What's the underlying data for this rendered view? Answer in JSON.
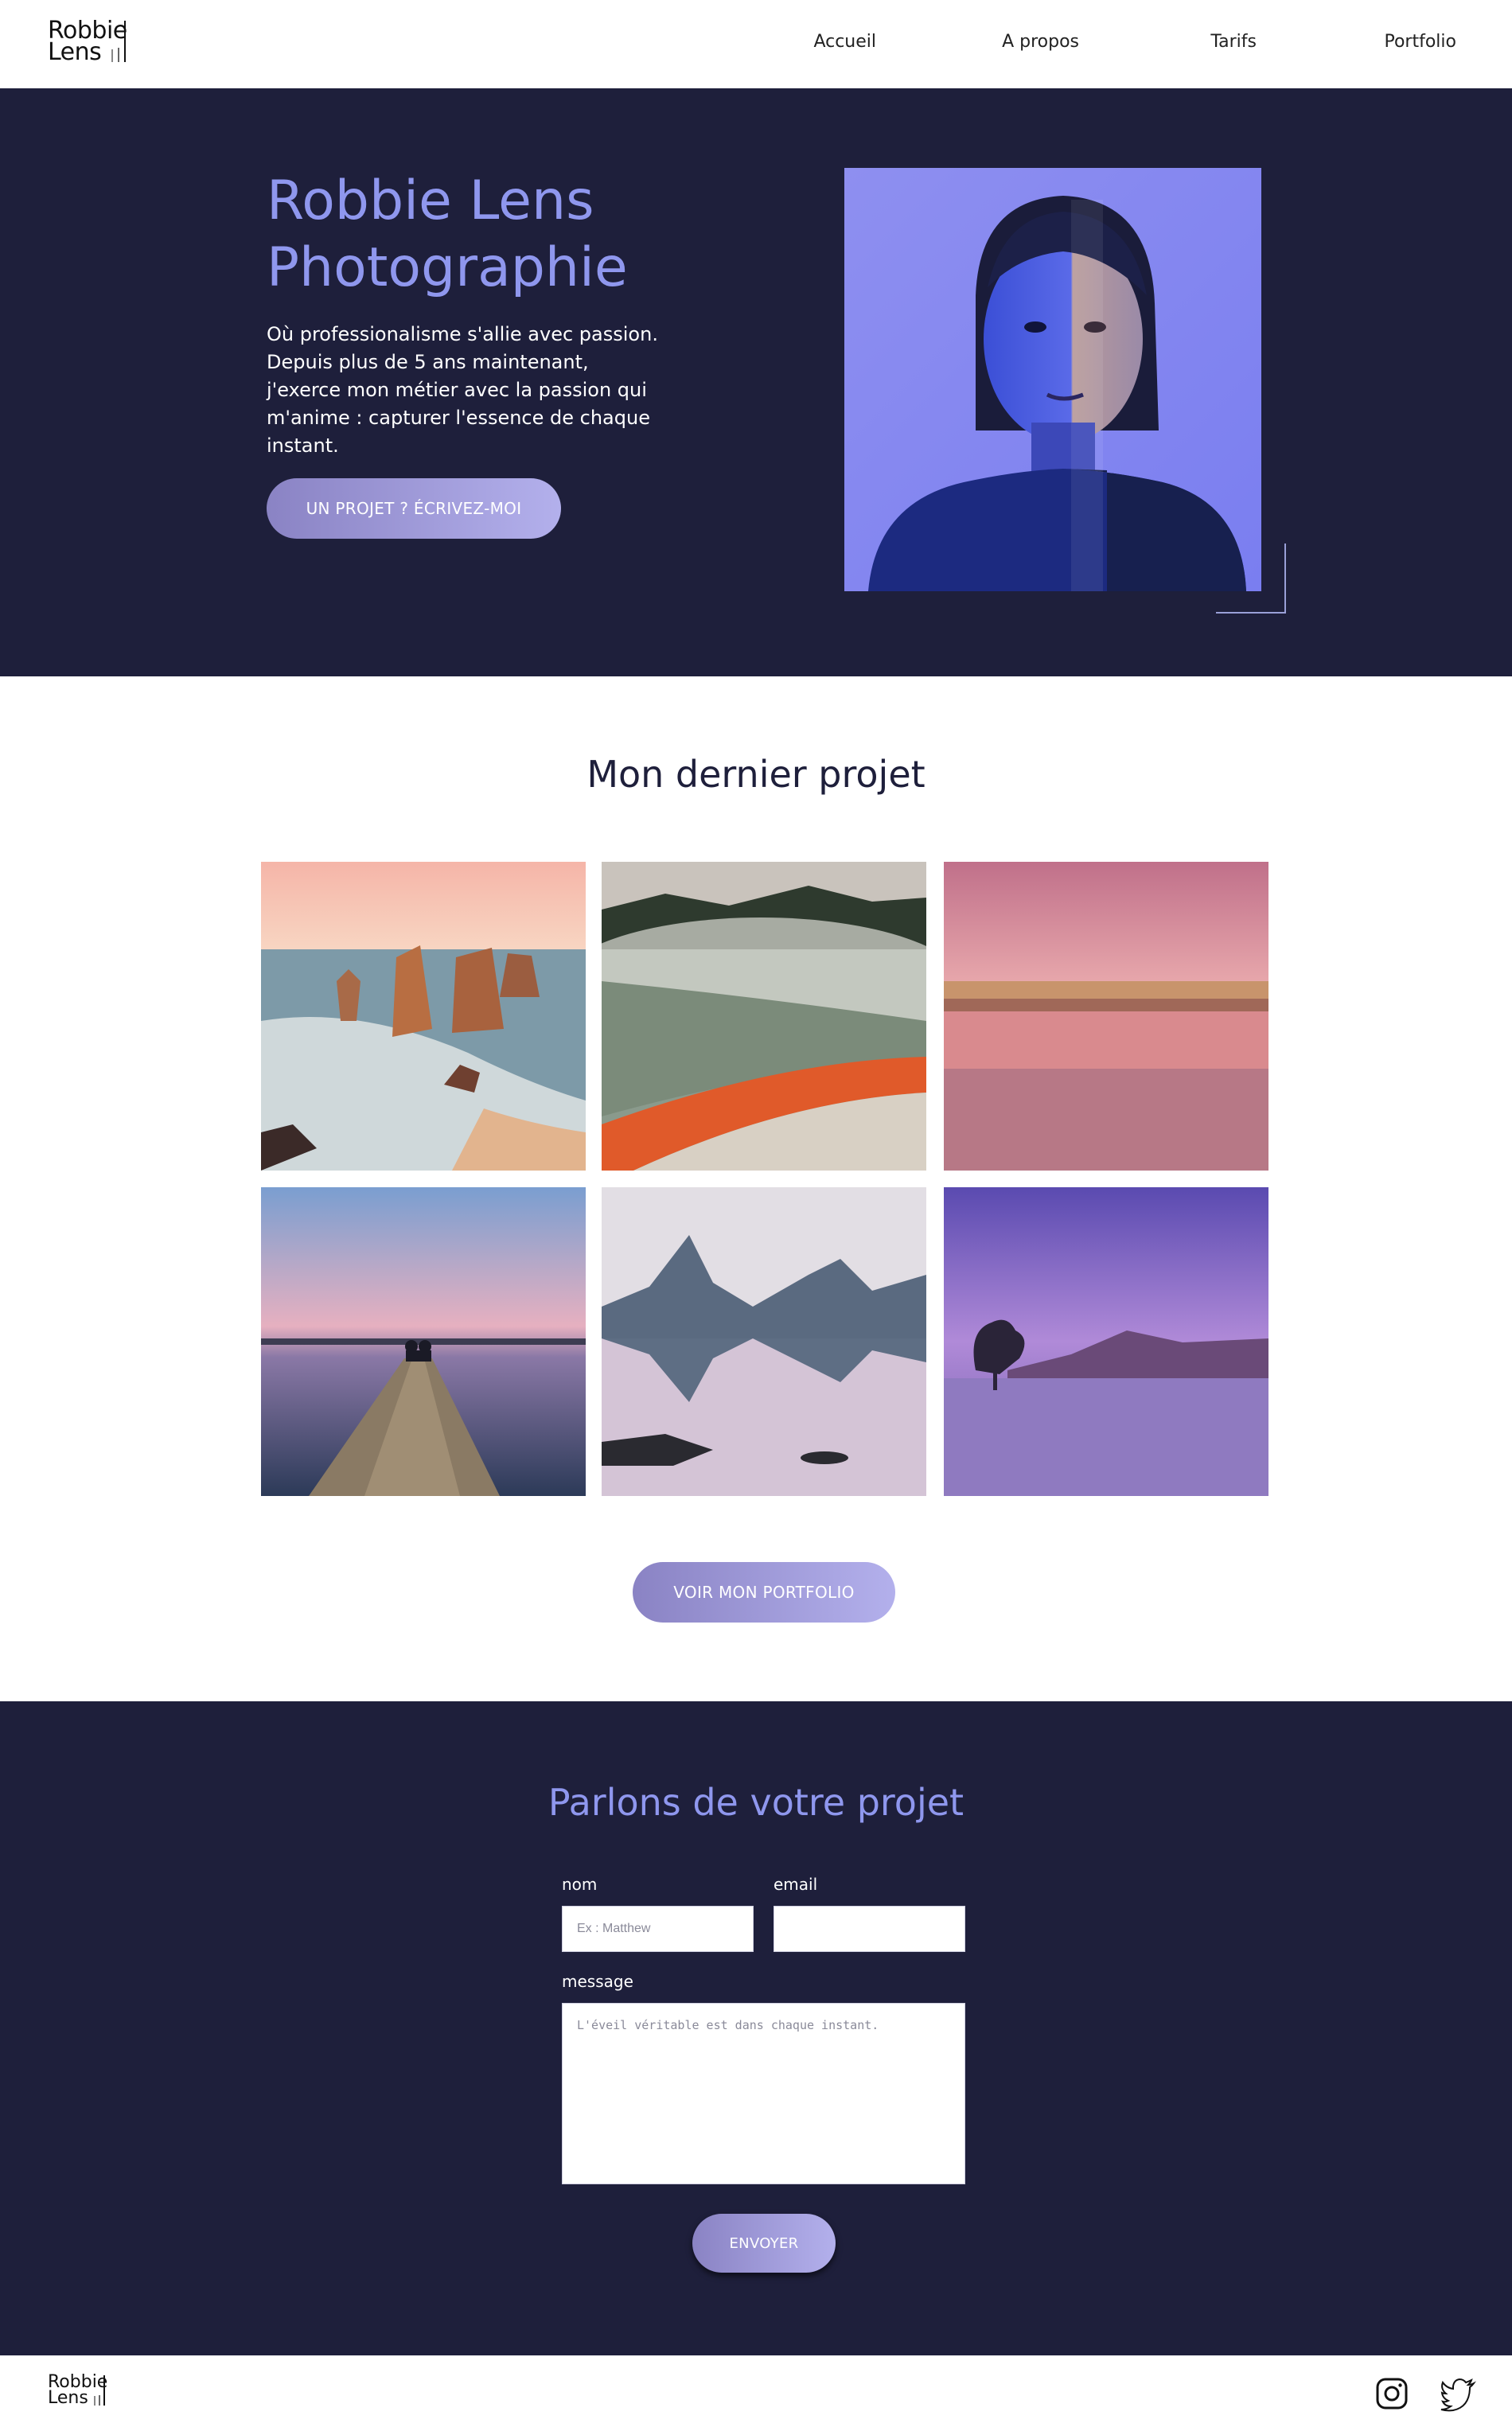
{
  "header": {
    "logo_line1": "Robbie",
    "logo_line2": "Lens",
    "nav": [
      {
        "label": "Accueil"
      },
      {
        "label": "A propos"
      },
      {
        "label": "Tarifs"
      },
      {
        "label": "Portfolio"
      }
    ]
  },
  "hero": {
    "title_line1": "Robbie Lens",
    "title_line2": "Photographie",
    "text": "Où professionalisme s'allie avec passion. Depuis plus de 5 ans maintenant, j'exerce mon métier avec la passion qui m'anime : capturer l'essence de chaque instant.",
    "cta_label": "UN PROJET ? ÉCRIVEZ-MOI"
  },
  "project": {
    "title": "Mon dernier projet",
    "photos": [
      {
        "subject": "sea-stacks-sunset"
      },
      {
        "subject": "hot-spring-lake"
      },
      {
        "subject": "pink-lake-reflection"
      },
      {
        "subject": "couple-on-pier"
      },
      {
        "subject": "mountain-reflection"
      },
      {
        "subject": "lone-tree-lake"
      }
    ],
    "portfolio_label": "VOIR MON PORTFOLIO"
  },
  "contact": {
    "title": "Parlons de votre projet",
    "name_label": "nom",
    "name_placeholder": "Ex : Matthew",
    "email_label": "email",
    "email_value": "",
    "message_label": "message",
    "message_placeholder": "L'éveil véritable est dans chaque instant.",
    "send_label": "ENVOYER"
  },
  "footer": {
    "logo_line1": "Robbie",
    "logo_line2": "Lens",
    "icons": [
      "instagram-icon",
      "twitter-icon"
    ]
  },
  "colors": {
    "navy": "#1e1f3b",
    "accent": "#8f97ee",
    "button_start": "#8a83c4",
    "button_end": "#b3b0ec"
  }
}
